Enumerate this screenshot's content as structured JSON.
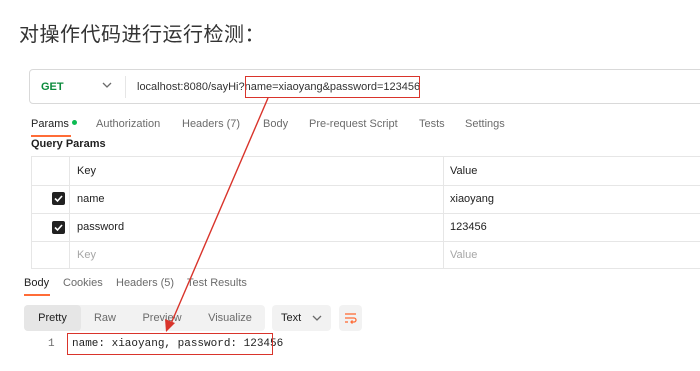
{
  "heading": "对操作代码进行运行检测：",
  "request": {
    "method": "GET",
    "url": "localhost:8080/sayHi?name=xiaoyang&password=123456"
  },
  "request_tabs": [
    {
      "label": "Params",
      "active": true
    },
    {
      "label": "Authorization"
    },
    {
      "label": "Headers (7)"
    },
    {
      "label": "Body"
    },
    {
      "label": "Pre-request Script"
    },
    {
      "label": "Tests"
    },
    {
      "label": "Settings"
    }
  ],
  "query_params": {
    "title": "Query Params",
    "headers": [
      "Key",
      "Value"
    ],
    "rows": [
      {
        "key": "name",
        "value": "xiaoyang",
        "checked": true
      },
      {
        "key": "password",
        "value": "123456",
        "checked": true
      }
    ],
    "placeholder": {
      "key": "Key",
      "value": "Value"
    }
  },
  "response_tabs": [
    {
      "label": "Body",
      "active": true
    },
    {
      "label": "Cookies"
    },
    {
      "label": "Headers (5)"
    },
    {
      "label": "Test Results"
    }
  ],
  "view_modes": [
    "Pretty",
    "Raw",
    "Preview",
    "Visualize"
  ],
  "active_view_mode": "Pretty",
  "format": "Text",
  "response_body": {
    "line_number": "1",
    "text": "name: xiaoyang, password: 123456"
  },
  "colors": {
    "method_get": "#0b8a3b",
    "accent": "#ff6c37",
    "annotation": "#d9342b",
    "params_dot": "#0cbb52"
  }
}
